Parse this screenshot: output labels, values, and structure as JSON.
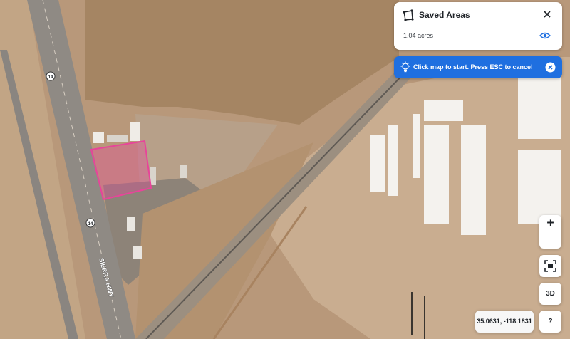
{
  "map": {
    "highway_shield_top": "14",
    "highway_shield_bottom": "14",
    "road_label": "SIERRA HWY",
    "selection_color": "#e8449a"
  },
  "saved_areas": {
    "title": "Saved Areas",
    "items": [
      {
        "area": "1.04 acres"
      }
    ]
  },
  "banner": {
    "text": "Click map to start. Press ESC to cancel",
    "color": "#1f6fe0"
  },
  "controls": {
    "zoom_in": "+",
    "zoom_out": "−",
    "three_d": "3D",
    "help": "?"
  },
  "coordinates": {
    "readout": "35.0631, -118.1831"
  },
  "icons": {
    "polygon": "polygon-draw-icon",
    "close": "close-icon",
    "eye": "eye-icon",
    "bulb": "lightbulb-icon",
    "cancel": "cancel-circle-icon",
    "fit": "fit-bounds-icon"
  }
}
